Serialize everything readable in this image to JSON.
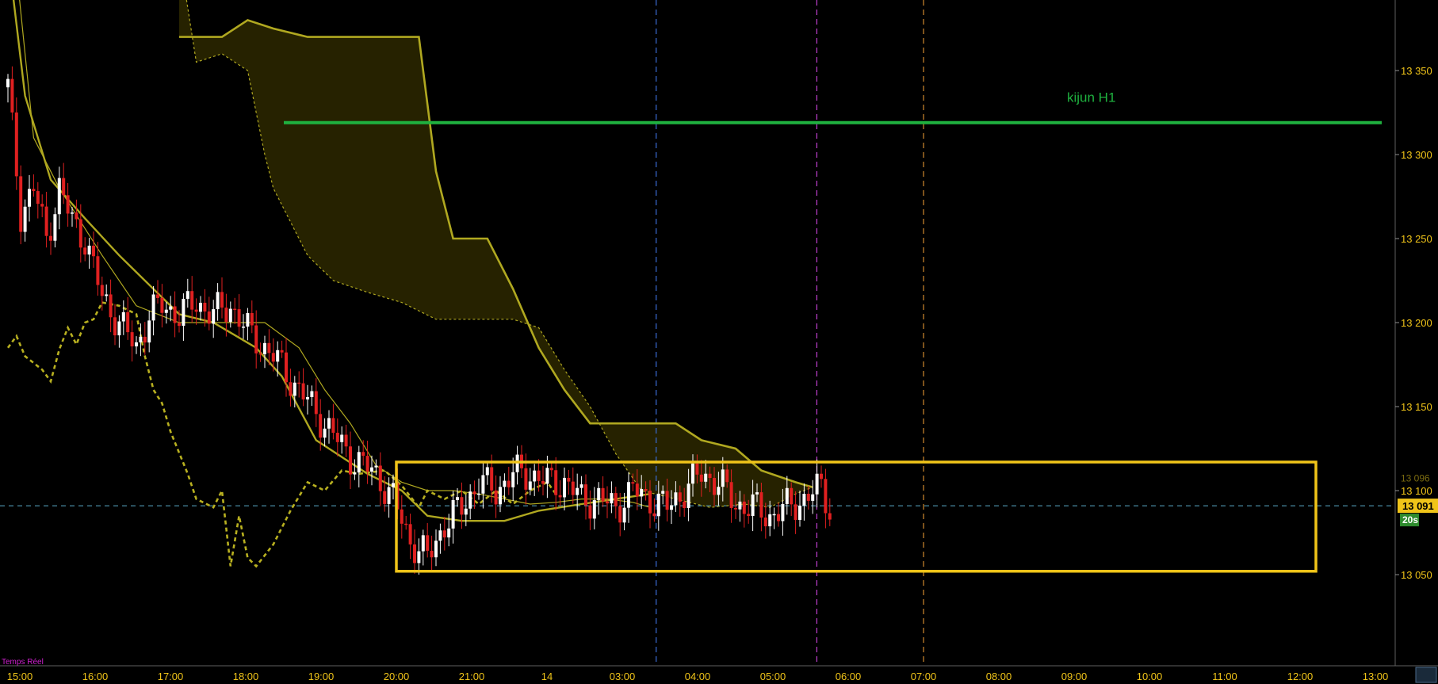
{
  "chart_data": {
    "type": "candlestick",
    "price_axis": {
      "ticks": [
        13050,
        13100,
        13150,
        13200,
        13250,
        13300,
        13350
      ],
      "tick_labels": [
        "13 050",
        "13 100",
        "13 150",
        "13 200",
        "13 250",
        "13 300",
        "13 350"
      ],
      "range": [
        13000,
        13385
      ]
    },
    "time_axis": {
      "labels": [
        "15:00",
        "16:00",
        "17:00",
        "18:00",
        "19:00",
        "20:00",
        "21:00",
        "14",
        "03:00",
        "04:00",
        "05:00",
        "06:00",
        "07:00",
        "08:00",
        "09:00",
        "10:00",
        "11:00",
        "12:00",
        "13:00"
      ]
    },
    "current_price": {
      "value": 13091,
      "label": "13 091",
      "countdown": "20s"
    },
    "hidden_price_label": "13 096",
    "kijun_h1": {
      "label": "kijun H1",
      "value": 13319,
      "color": "#1fb13f"
    },
    "range_box": {
      "from": "20:00",
      "to": "12:00",
      "high": 13117,
      "low": 13052,
      "color": "#f0c419"
    },
    "session_lines": [
      {
        "time": "03:27",
        "color": "#3a6bd6"
      },
      {
        "time": "05:35",
        "color": "#c040d0"
      },
      {
        "time": "07:00",
        "color": "#d08a30"
      }
    ],
    "status_text": "Temps Réel",
    "colors": {
      "bull": "#ffffff",
      "bear": "#e02020",
      "cloud_fill": "#2a2600",
      "span": "#b0a820",
      "chikou": "#b8b020",
      "price_line": "#5aa9c8",
      "axis_text": "#f0c419",
      "current_badge": "#f0c419",
      "countdown_badge": "#2e8b2e"
    },
    "ichimoku": {
      "tenkan": [
        [
          0,
          13410
        ],
        [
          2,
          13410
        ],
        [
          6,
          13310
        ],
        [
          12,
          13280
        ],
        [
          22,
          13240
        ],
        [
          30,
          13210
        ],
        [
          40,
          13200
        ],
        [
          50,
          13200
        ],
        [
          60,
          13200
        ],
        [
          68,
          13185
        ],
        [
          74,
          13160
        ],
        [
          80,
          13140
        ],
        [
          86,
          13115
        ],
        [
          92,
          13105
        ],
        [
          98,
          13100
        ],
        [
          104,
          13100
        ],
        [
          110,
          13098
        ],
        [
          116,
          13095
        ],
        [
          122,
          13092
        ],
        [
          128,
          13093
        ],
        [
          134,
          13095
        ],
        [
          140,
          13095
        ],
        [
          146,
          13093
        ],
        [
          150,
          13090
        ]
      ],
      "kijun": [
        [
          0,
          13420
        ],
        [
          4,
          13335
        ],
        [
          10,
          13285
        ],
        [
          18,
          13262
        ],
        [
          26,
          13240
        ],
        [
          34,
          13220
        ],
        [
          40,
          13205
        ],
        [
          48,
          13200
        ],
        [
          52,
          13194
        ],
        [
          58,
          13185
        ],
        [
          64,
          13168
        ],
        [
          72,
          13130
        ],
        [
          78,
          13120
        ],
        [
          84,
          13110
        ],
        [
          92,
          13100
        ],
        [
          98,
          13085
        ],
        [
          106,
          13082
        ],
        [
          116,
          13082
        ],
        [
          124,
          13088
        ],
        [
          134,
          13092
        ],
        [
          142,
          13095
        ],
        [
          150,
          13098
        ]
      ],
      "span_a": [
        [
          40,
          13370
        ],
        [
          50,
          13370
        ],
        [
          56,
          13380
        ],
        [
          62,
          13375
        ],
        [
          70,
          13370
        ],
        [
          80,
          13370
        ],
        [
          90,
          13370
        ],
        [
          96,
          13370
        ],
        [
          100,
          13290
        ],
        [
          104,
          13250
        ],
        [
          112,
          13250
        ],
        [
          118,
          13220
        ],
        [
          124,
          13185
        ],
        [
          130,
          13160
        ],
        [
          136,
          13140
        ],
        [
          142,
          13140
        ],
        [
          156,
          13140
        ],
        [
          162,
          13130
        ],
        [
          170,
          13125
        ],
        [
          176,
          13112
        ],
        [
          184,
          13105
        ],
        [
          188,
          13102
        ]
      ],
      "span_b": [
        [
          40,
          13420
        ],
        [
          44,
          13355
        ],
        [
          50,
          13360
        ],
        [
          56,
          13350
        ],
        [
          60,
          13300
        ],
        [
          62,
          13280
        ],
        [
          66,
          13260
        ],
        [
          70,
          13240
        ],
        [
          76,
          13225
        ],
        [
          84,
          13218
        ],
        [
          92,
          13212
        ],
        [
          100,
          13202
        ],
        [
          108,
          13202
        ],
        [
          118,
          13202
        ],
        [
          124,
          13197
        ],
        [
          130,
          13172
        ],
        [
          136,
          13150
        ],
        [
          142,
          13122
        ],
        [
          148,
          13100
        ],
        [
          156,
          13095
        ],
        [
          164,
          13090
        ],
        [
          172,
          13092
        ],
        [
          178,
          13090
        ],
        [
          184,
          13098
        ],
        [
          188,
          13102
        ]
      ],
      "chikou": [
        [
          0,
          13185
        ],
        [
          2,
          13192
        ],
        [
          4,
          13180
        ],
        [
          6,
          13176
        ],
        [
          8,
          13172
        ],
        [
          10,
          13165
        ],
        [
          12,
          13184
        ],
        [
          14,
          13197
        ],
        [
          16,
          13187
        ],
        [
          18,
          13200
        ],
        [
          20,
          13202
        ],
        [
          22,
          13212
        ],
        [
          26,
          13210
        ],
        [
          30,
          13205
        ],
        [
          32,
          13180
        ],
        [
          34,
          13160
        ],
        [
          36,
          13152
        ],
        [
          38,
          13135
        ],
        [
          42,
          13110
        ],
        [
          44,
          13095
        ],
        [
          48,
          13090
        ],
        [
          50,
          13100
        ],
        [
          52,
          13055
        ],
        [
          54,
          13085
        ],
        [
          56,
          13060
        ],
        [
          58,
          13055
        ],
        [
          62,
          13068
        ],
        [
          66,
          13088
        ],
        [
          70,
          13105
        ],
        [
          74,
          13100
        ],
        [
          78,
          13112
        ],
        [
          82,
          13110
        ],
        [
          88,
          13112
        ],
        [
          92,
          13103
        ],
        [
          96,
          13090
        ],
        [
          98,
          13100
        ],
        [
          102,
          13095
        ],
        [
          106,
          13100
        ],
        [
          110,
          13092
        ],
        [
          114,
          13100
        ],
        [
          118,
          13092
        ],
        [
          122,
          13100
        ],
        [
          126,
          13105
        ],
        [
          128,
          13098
        ]
      ]
    }
  }
}
